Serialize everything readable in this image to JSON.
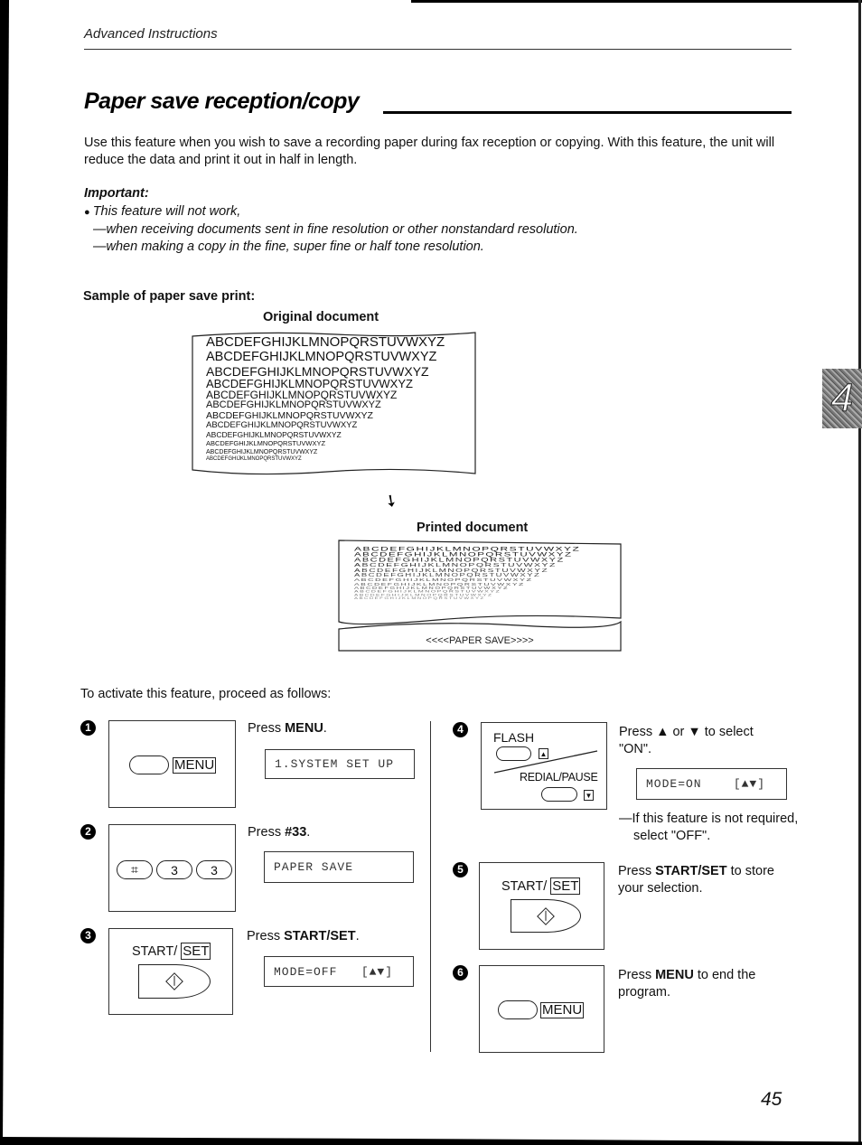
{
  "header": {
    "section_label": "Advanced Instructions"
  },
  "title": "Paper save reception/copy",
  "intro": "Use this feature when you wish to save a recording paper during fax reception or copying. With this feature, the unit will reduce the data and print it out in half in length.",
  "important": {
    "heading": "Important:",
    "bullet": "This feature will not work,",
    "conditions": [
      "—when receiving documents sent in fine resolution or other nonstandard resolution.",
      "—when making a copy in the fine, super fine or half tone resolution."
    ]
  },
  "sample": {
    "heading": "Sample of paper save print:",
    "original_label": "Original document",
    "printed_label": "Printed document",
    "line_text": "ABCDEFGHIJKLMNOPQRSTUVWXYZ",
    "original_line_count": 12,
    "printed_line_count": 12,
    "banner": "<<<<PAPER SAVE>>>>",
    "arrow_icon": "down-arrow"
  },
  "proceed_text": "To activate this feature, proceed as follows:",
  "steps": [
    {
      "number": "1",
      "instruction_prefix": "Press ",
      "instruction_bold": "MENU",
      "instruction_suffix": ".",
      "display": "1.SYSTEM SET UP",
      "panel": {
        "key_label": "MENU"
      }
    },
    {
      "number": "2",
      "instruction_prefix": "Press ",
      "instruction_bold": "#33",
      "instruction_suffix": ".",
      "display": "PAPER SAVE",
      "panel": {
        "keys": [
          "⌗",
          "3",
          "3"
        ]
      }
    },
    {
      "number": "3",
      "instruction_prefix": "Press ",
      "instruction_bold": "START/SET",
      "instruction_suffix": ".",
      "display": "MODE=OFF   [▲▼]",
      "panel": {
        "label_prefix": "START/",
        "label_boxed": "SET"
      }
    },
    {
      "number": "4",
      "instruction": "Press ▲ or ▼ to select \"ON\".",
      "display": "MODE=ON    [▲▼]",
      "note": "—If this feature is not required, select \"OFF\".",
      "panel": {
        "flash_label": "FLASH",
        "up_symbol": "▲",
        "redial_label": "REDIAL/PAUSE",
        "down_symbol": "▼"
      }
    },
    {
      "number": "5",
      "instruction_bold": "START/SET",
      "instruction_prefix": "Press ",
      "instruction_suffix": " to store your selection.",
      "panel": {
        "label_prefix": "START/",
        "label_boxed": "SET"
      }
    },
    {
      "number": "6",
      "instruction_prefix": "Press ",
      "instruction_bold": "MENU",
      "instruction_suffix": " to end the program.",
      "panel": {
        "key_label": "MENU"
      }
    }
  ],
  "section_tab": "4",
  "page_number": "45"
}
